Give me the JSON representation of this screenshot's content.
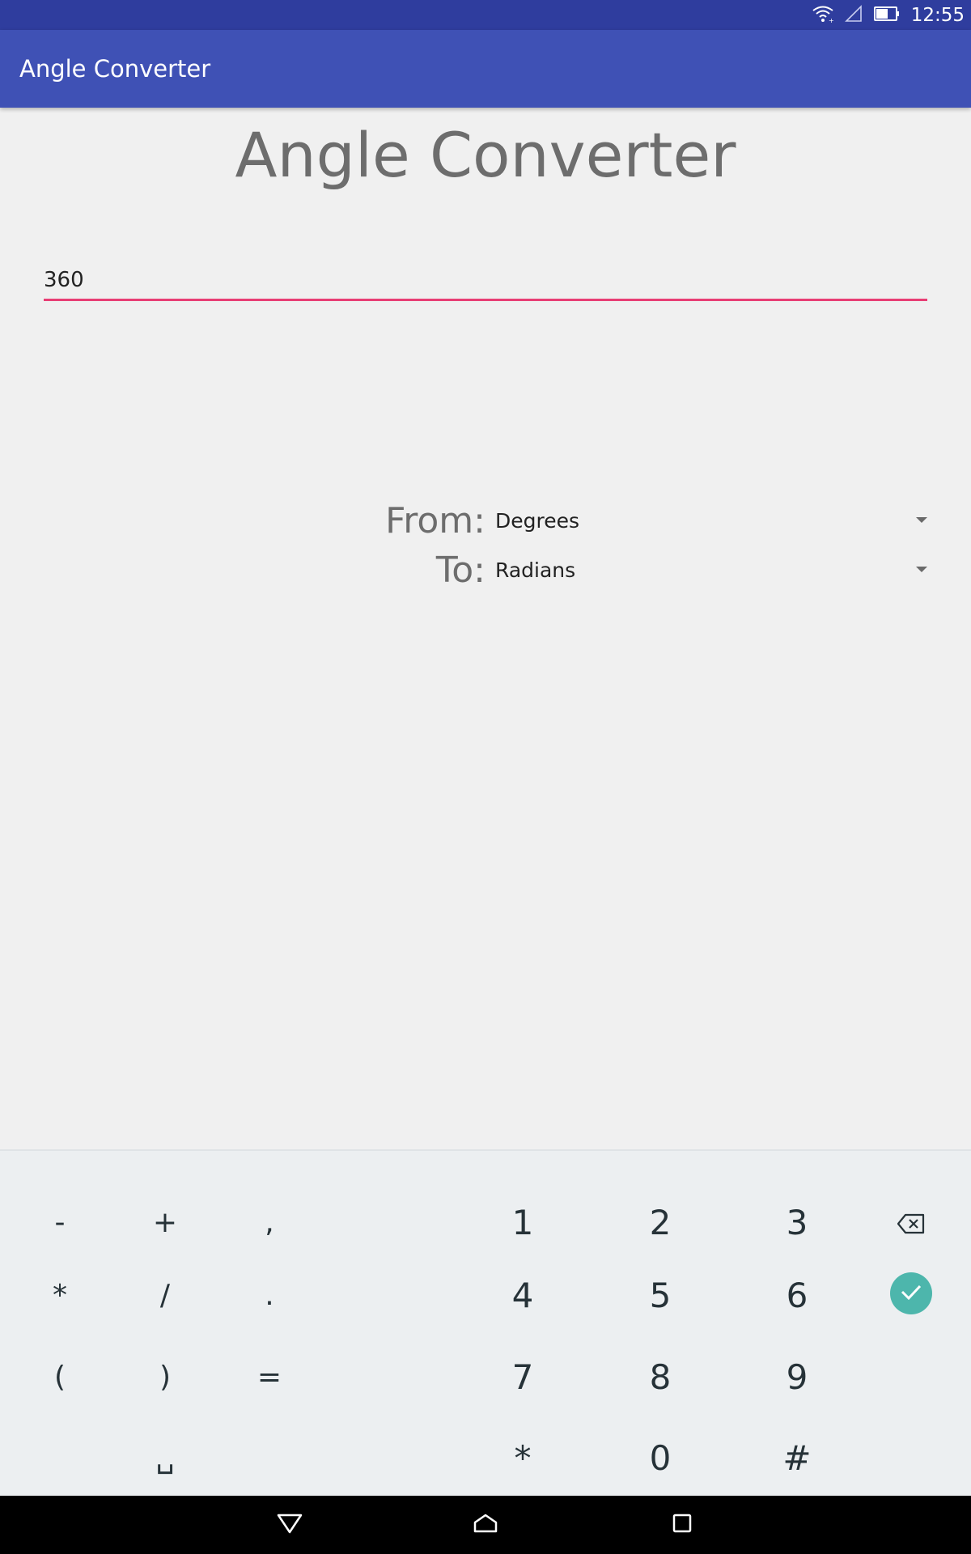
{
  "status_bar": {
    "time": "12:55",
    "icons": [
      "wifi-icon",
      "cell-signal-icon",
      "battery-icon"
    ]
  },
  "app_bar": {
    "title": "Angle Converter"
  },
  "main": {
    "heading": "Angle Converter",
    "input_value": "360",
    "from_label": "From:",
    "from_value": "Degrees",
    "to_label": "To:",
    "to_value": "Radians"
  },
  "keyboard": {
    "keys": {
      "minus": "-",
      "plus": "+",
      "comma": ",",
      "k1": "1",
      "k2": "2",
      "k3": "3",
      "asterisk": "*",
      "slash": "/",
      "period": ".",
      "k4": "4",
      "k5": "5",
      "k6": "6",
      "lparen": "(",
      "rparen": ")",
      "equals": "=",
      "k7": "7",
      "k8": "8",
      "k9": "9",
      "space": "␣",
      "star": "*",
      "k0": "0",
      "hash": "#"
    },
    "icons": [
      "backspace-icon",
      "check-icon"
    ],
    "accent_color": "#4db6ac"
  },
  "nav_bar": {
    "icons": [
      "back-icon",
      "home-icon",
      "recents-icon"
    ]
  },
  "colors": {
    "status_bar": "#2f3d9e",
    "app_bar": "#3f51b5",
    "input_underline": "#e83e74",
    "background": "#f0f0f0",
    "keyboard": "#eceff1"
  }
}
